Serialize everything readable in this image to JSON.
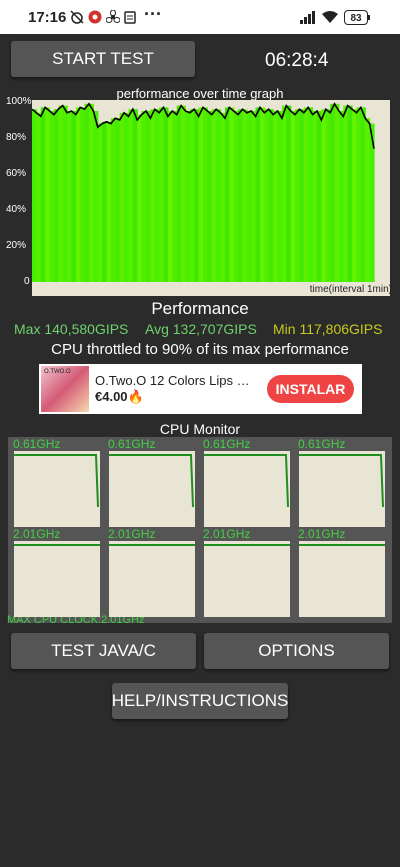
{
  "status_bar": {
    "time": "17:16",
    "icons": [
      "alarm-off-icon",
      "app-notification-icon",
      "fan-icon",
      "clipboard-icon",
      "more-icon"
    ],
    "right_icons": [
      "signal-icon",
      "wifi-icon",
      "battery-icon"
    ],
    "battery_level": "83"
  },
  "controls": {
    "start_test_label": "START TEST",
    "timer": "06:28:4",
    "test_java_label": "TEST JAVA/C",
    "options_label": "OPTIONS",
    "help_label": "HELP/INSTRUCTIONS"
  },
  "graph": {
    "title": "performance over time graph",
    "x_label": "time(interval 1min)",
    "y_ticks": [
      "100%",
      "80%",
      "60%",
      "40%",
      "20%",
      "0"
    ],
    "fill_color": "#4cf000",
    "line_color": "#000000",
    "bg_color": "#e9e5d5"
  },
  "chart_data": {
    "type": "area",
    "title": "performance over time graph",
    "xlabel": "time(interval 1min)",
    "ylabel": "",
    "ylim": [
      0,
      100
    ],
    "values": [
      96,
      94,
      92,
      97,
      95,
      93,
      96,
      98,
      94,
      95,
      93,
      97,
      96,
      99,
      95,
      86,
      88,
      89,
      88,
      91,
      90,
      94,
      92,
      96,
      90,
      93,
      95,
      91,
      96,
      94,
      97,
      92,
      95,
      93,
      98,
      95,
      94,
      96,
      92,
      97,
      95,
      93,
      96,
      94,
      91,
      97,
      95,
      93,
      96,
      94,
      95,
      92,
      97,
      94,
      96,
      93,
      95,
      91,
      98,
      95,
      93,
      96,
      94,
      97,
      93,
      95,
      90,
      96,
      94,
      99,
      95,
      92,
      98,
      96,
      94,
      97,
      91,
      88,
      74
    ]
  },
  "performance": {
    "title": "Performance",
    "max": "Max 140,580GIPS",
    "avg": "Avg 132,707GIPS",
    "min": "Min 117,806GIPS",
    "throttle_text": "CPU throttled to 90% of its max performance"
  },
  "ad": {
    "brand_text": "O.TWO.O",
    "title": "O.Two.O 12 Colors Lips Ma...",
    "price": "€4.00🔥",
    "install_label": "INSTALAR"
  },
  "cpu_monitor": {
    "title": "CPU Monitor",
    "max_clock": "MAX CPU CLOCK:2.01GHz",
    "cores": [
      {
        "freq": "0.61GHz",
        "level": 0.92,
        "drop": true
      },
      {
        "freq": "0.61GHz",
        "level": 0.92,
        "drop": true
      },
      {
        "freq": "0.61GHz",
        "level": 0.92,
        "drop": true
      },
      {
        "freq": "0.61GHz",
        "level": 0.92,
        "drop": true
      },
      {
        "freq": "2.01GHz",
        "level": 1.0,
        "drop": false
      },
      {
        "freq": "2.01GHz",
        "level": 1.0,
        "drop": false
      },
      {
        "freq": "2.01GHz",
        "level": 1.0,
        "drop": false
      },
      {
        "freq": "2.01GHz",
        "level": 1.0,
        "drop": false
      }
    ]
  }
}
